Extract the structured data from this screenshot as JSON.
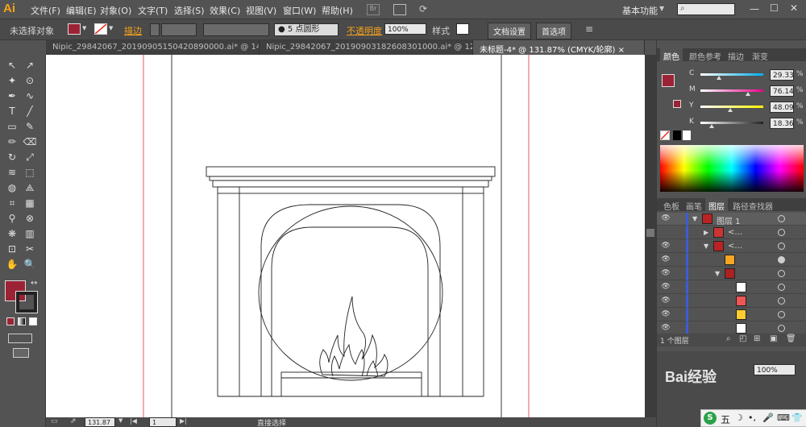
{
  "app": {
    "logo": "Ai",
    "workspace": "基本功能",
    "search_placeholder": ""
  },
  "menu": [
    "文件(F)",
    "编辑(E)",
    "对象(O)",
    "文字(T)",
    "选择(S)",
    "效果(C)",
    "视图(V)",
    "窗口(W)",
    "帮助(H)"
  ],
  "control": {
    "selection": "未选择对象",
    "stroke_label": "描边",
    "brush": "5 点圆形",
    "opacity_label": "不透明度",
    "opacity": "100%",
    "style_label": "样式",
    "doc_setup": "文档设置",
    "prefs": "首选项",
    "fill_color": "#9b2335"
  },
  "tabs": [
    {
      "label": "Nipic_29842067_20190905150420890000.ai* @ 143..."
    },
    {
      "label": "Nipic_29842067_20190903182608301000.ai* @ 124..."
    },
    {
      "label": "未标题-4* @ 131.87% (CMYK/轮廓)"
    }
  ],
  "tools": [
    "selection-arrow-icon",
    "direct-select-icon",
    "magic-wand-icon",
    "lasso-icon",
    "pen-icon",
    "curvature-icon",
    "type-icon",
    "line-icon",
    "rectangle-icon",
    "paintbrush-icon",
    "pencil-icon",
    "eraser-icon",
    "rotate-icon",
    "scale-icon",
    "warp-icon",
    "free-transform-icon",
    "shape-builder-icon",
    "perspective-icon",
    "mesh-icon",
    "gradient-icon",
    "eyedropper-icon",
    "blend-icon",
    "symbol-sprayer-icon",
    "column-graph-icon",
    "artboard-icon",
    "slice-icon",
    "hand-icon",
    "zoom-icon"
  ],
  "color_panel": {
    "tabs": [
      "颜色",
      "颜色参考",
      "描边",
      "渐变"
    ],
    "channels": [
      {
        "name": "C",
        "value": "29.33",
        "pct": 0.29,
        "color": "#00aeef"
      },
      {
        "name": "M",
        "value": "76.14",
        "pct": 0.76,
        "color": "#ec008c"
      },
      {
        "name": "Y",
        "value": "48.09",
        "pct": 0.48,
        "color": "#fff200"
      },
      {
        "name": "K",
        "value": "18.36",
        "pct": 0.18,
        "color": "#222222"
      }
    ]
  },
  "layers_panel": {
    "tabs": [
      "色板",
      "画笔",
      "图层",
      "路径查找器"
    ],
    "layer_name": "图层 1",
    "sub_label": "<...",
    "count": "1 个图层"
  },
  "status": {
    "zoom": "131.87",
    "page": "1",
    "tool": "直接选择"
  },
  "watermark": "Bai经验",
  "ime": "五"
}
